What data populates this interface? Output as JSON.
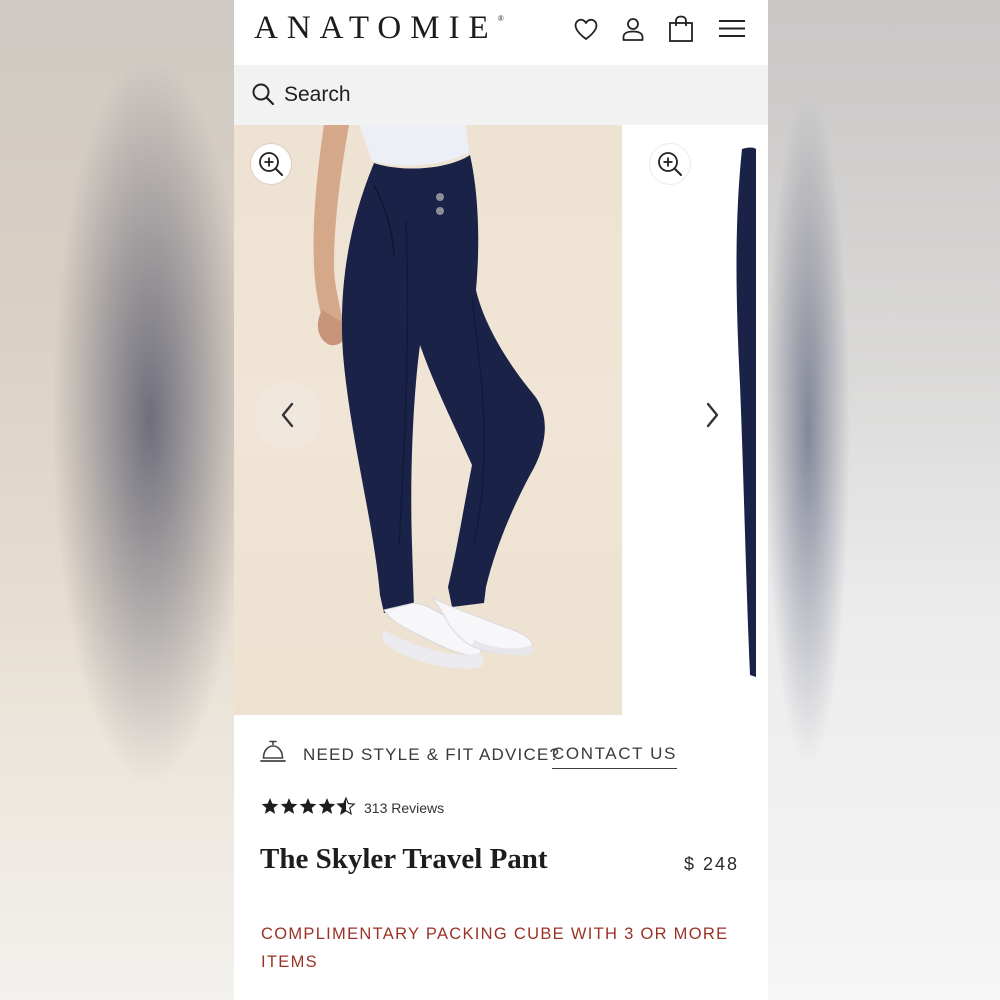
{
  "header": {
    "brand": "ANATOMIE",
    "trademark": "®",
    "icons": [
      "heart-icon",
      "account-icon",
      "bag-icon",
      "menu-icon"
    ]
  },
  "search": {
    "label": "Search",
    "icon": "search-icon"
  },
  "gallery": {
    "icons": [
      "zoom-in-icon",
      "chevron-left-icon",
      "chevron-right-icon"
    ]
  },
  "advice": {
    "text": "NEED STYLE & FIT ADVICE?",
    "link": "CONTACT US",
    "icon": "service-bell-icon"
  },
  "product": {
    "rating": 4.5,
    "reviews": "313 Reviews",
    "title": "The Skyler Travel Pant",
    "price": "$ 248",
    "promo": "COMPLIMENTARY PACKING CUBE WITH 3 OR MORE ITEMS"
  },
  "colors": {
    "promo": "#9b3226",
    "pant": "#1b2248",
    "text": "#1d1d1d"
  }
}
